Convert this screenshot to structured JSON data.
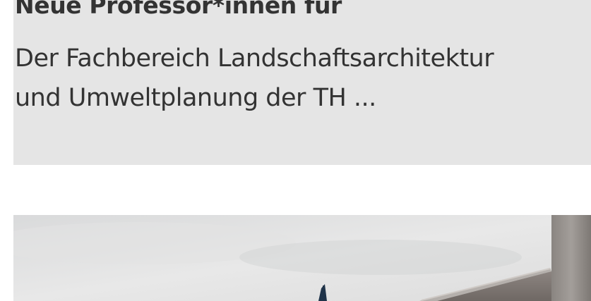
{
  "news_item": {
    "title": "Neue Professor*innen für",
    "teaser_line_1": "Der Fachbereich Landschaftsarchitektur",
    "teaser_line_2": "und Umweltplanung der TH ..."
  },
  "colors": {
    "card_background": "#e5e5e5",
    "text": "#333333",
    "page_background": "#ffffff"
  }
}
